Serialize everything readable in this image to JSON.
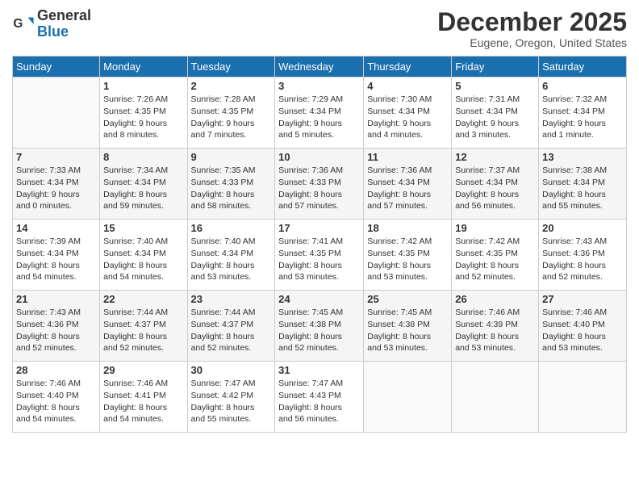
{
  "logo": {
    "general": "General",
    "blue": "Blue"
  },
  "title": "December 2025",
  "location": "Eugene, Oregon, United States",
  "headers": [
    "Sunday",
    "Monday",
    "Tuesday",
    "Wednesday",
    "Thursday",
    "Friday",
    "Saturday"
  ],
  "weeks": [
    [
      {
        "day": "",
        "info": ""
      },
      {
        "day": "1",
        "info": "Sunrise: 7:26 AM\nSunset: 4:35 PM\nDaylight: 9 hours\nand 8 minutes."
      },
      {
        "day": "2",
        "info": "Sunrise: 7:28 AM\nSunset: 4:35 PM\nDaylight: 9 hours\nand 7 minutes."
      },
      {
        "day": "3",
        "info": "Sunrise: 7:29 AM\nSunset: 4:34 PM\nDaylight: 9 hours\nand 5 minutes."
      },
      {
        "day": "4",
        "info": "Sunrise: 7:30 AM\nSunset: 4:34 PM\nDaylight: 9 hours\nand 4 minutes."
      },
      {
        "day": "5",
        "info": "Sunrise: 7:31 AM\nSunset: 4:34 PM\nDaylight: 9 hours\nand 3 minutes."
      },
      {
        "day": "6",
        "info": "Sunrise: 7:32 AM\nSunset: 4:34 PM\nDaylight: 9 hours\nand 1 minute."
      }
    ],
    [
      {
        "day": "7",
        "info": "Sunrise: 7:33 AM\nSunset: 4:34 PM\nDaylight: 9 hours\nand 0 minutes."
      },
      {
        "day": "8",
        "info": "Sunrise: 7:34 AM\nSunset: 4:34 PM\nDaylight: 8 hours\nand 59 minutes."
      },
      {
        "day": "9",
        "info": "Sunrise: 7:35 AM\nSunset: 4:33 PM\nDaylight: 8 hours\nand 58 minutes."
      },
      {
        "day": "10",
        "info": "Sunrise: 7:36 AM\nSunset: 4:33 PM\nDaylight: 8 hours\nand 57 minutes."
      },
      {
        "day": "11",
        "info": "Sunrise: 7:36 AM\nSunset: 4:34 PM\nDaylight: 8 hours\nand 57 minutes."
      },
      {
        "day": "12",
        "info": "Sunrise: 7:37 AM\nSunset: 4:34 PM\nDaylight: 8 hours\nand 56 minutes."
      },
      {
        "day": "13",
        "info": "Sunrise: 7:38 AM\nSunset: 4:34 PM\nDaylight: 8 hours\nand 55 minutes."
      }
    ],
    [
      {
        "day": "14",
        "info": "Sunrise: 7:39 AM\nSunset: 4:34 PM\nDaylight: 8 hours\nand 54 minutes."
      },
      {
        "day": "15",
        "info": "Sunrise: 7:40 AM\nSunset: 4:34 PM\nDaylight: 8 hours\nand 54 minutes."
      },
      {
        "day": "16",
        "info": "Sunrise: 7:40 AM\nSunset: 4:34 PM\nDaylight: 8 hours\nand 53 minutes."
      },
      {
        "day": "17",
        "info": "Sunrise: 7:41 AM\nSunset: 4:35 PM\nDaylight: 8 hours\nand 53 minutes."
      },
      {
        "day": "18",
        "info": "Sunrise: 7:42 AM\nSunset: 4:35 PM\nDaylight: 8 hours\nand 53 minutes."
      },
      {
        "day": "19",
        "info": "Sunrise: 7:42 AM\nSunset: 4:35 PM\nDaylight: 8 hours\nand 52 minutes."
      },
      {
        "day": "20",
        "info": "Sunrise: 7:43 AM\nSunset: 4:36 PM\nDaylight: 8 hours\nand 52 minutes."
      }
    ],
    [
      {
        "day": "21",
        "info": "Sunrise: 7:43 AM\nSunset: 4:36 PM\nDaylight: 8 hours\nand 52 minutes."
      },
      {
        "day": "22",
        "info": "Sunrise: 7:44 AM\nSunset: 4:37 PM\nDaylight: 8 hours\nand 52 minutes."
      },
      {
        "day": "23",
        "info": "Sunrise: 7:44 AM\nSunset: 4:37 PM\nDaylight: 8 hours\nand 52 minutes."
      },
      {
        "day": "24",
        "info": "Sunrise: 7:45 AM\nSunset: 4:38 PM\nDaylight: 8 hours\nand 52 minutes."
      },
      {
        "day": "25",
        "info": "Sunrise: 7:45 AM\nSunset: 4:38 PM\nDaylight: 8 hours\nand 53 minutes."
      },
      {
        "day": "26",
        "info": "Sunrise: 7:46 AM\nSunset: 4:39 PM\nDaylight: 8 hours\nand 53 minutes."
      },
      {
        "day": "27",
        "info": "Sunrise: 7:46 AM\nSunset: 4:40 PM\nDaylight: 8 hours\nand 53 minutes."
      }
    ],
    [
      {
        "day": "28",
        "info": "Sunrise: 7:46 AM\nSunset: 4:40 PM\nDaylight: 8 hours\nand 54 minutes."
      },
      {
        "day": "29",
        "info": "Sunrise: 7:46 AM\nSunset: 4:41 PM\nDaylight: 8 hours\nand 54 minutes."
      },
      {
        "day": "30",
        "info": "Sunrise: 7:47 AM\nSunset: 4:42 PM\nDaylight: 8 hours\nand 55 minutes."
      },
      {
        "day": "31",
        "info": "Sunrise: 7:47 AM\nSunset: 4:43 PM\nDaylight: 8 hours\nand 56 minutes."
      },
      {
        "day": "",
        "info": ""
      },
      {
        "day": "",
        "info": ""
      },
      {
        "day": "",
        "info": ""
      }
    ]
  ]
}
